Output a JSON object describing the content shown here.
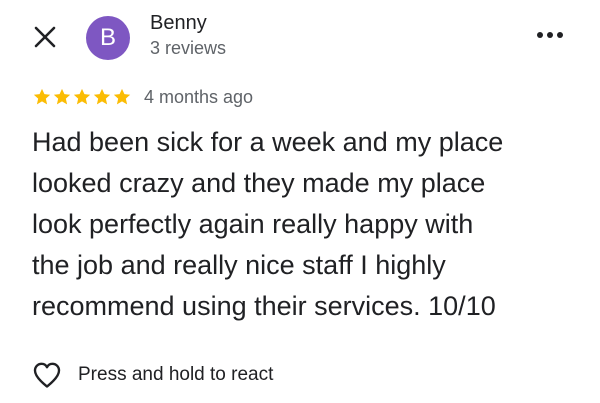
{
  "review": {
    "author": {
      "initial": "B",
      "name": "Benny",
      "reviews_count": "3 reviews",
      "avatar_color": "#7e57c2"
    },
    "rating": 5,
    "rating_max": 5,
    "star_color": "#fbbc04",
    "age": "4 months ago",
    "text_lines": [
      "Had been sick for a week and my place",
      "looked crazy and they made my place",
      "look perfectly again really happy with",
      "the job and really nice staff I highly",
      "recommend using their services. 10/10"
    ]
  },
  "actions": {
    "react_label": "Press and hold to react"
  },
  "icons": {
    "close": "close-icon",
    "more": "more-horizontal-icon",
    "star": "star-icon",
    "heart": "heart-outline-icon"
  }
}
